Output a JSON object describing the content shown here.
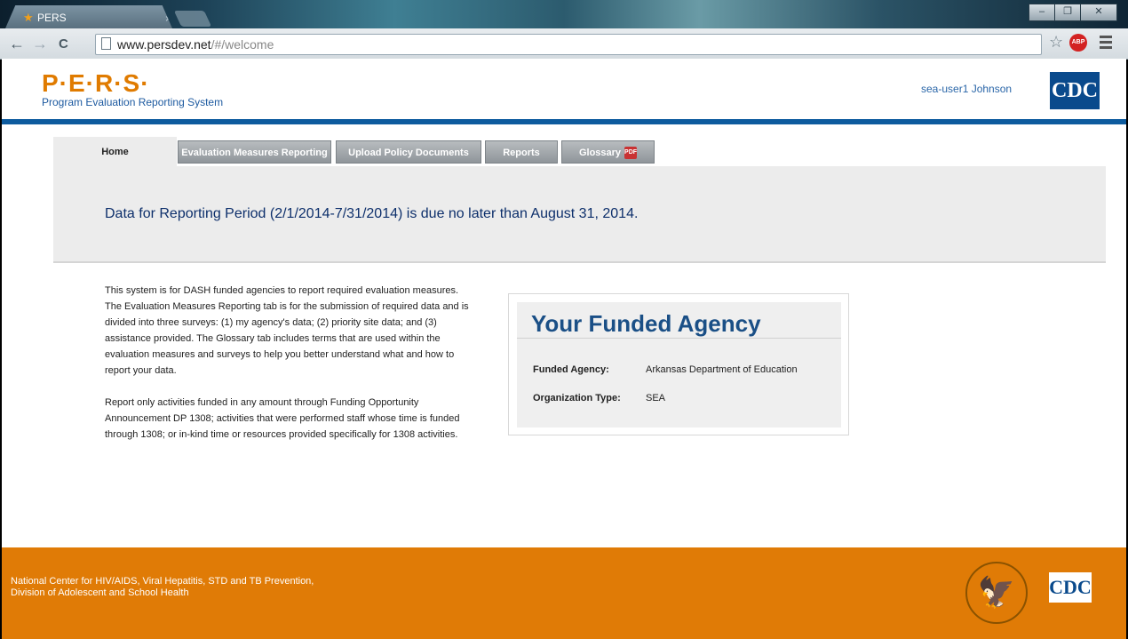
{
  "browser": {
    "tab_title": "PERS",
    "tab_close": "×",
    "url_host": "www.persdev.net",
    "url_path": "/#/welcome",
    "window_buttons": [
      "–",
      "❐",
      "✕"
    ],
    "back_icon": "←",
    "forward_icon": "→",
    "reload_icon": "C",
    "star_icon": "☆",
    "adblock_label": "ABP"
  },
  "header": {
    "logo": "P·E·R·S·",
    "tagline": "Program Evaluation Reporting System",
    "user": "sea-user1 Johnson",
    "cdc_logo": "CDC"
  },
  "nav": {
    "tabs": [
      {
        "label": "Home",
        "active": true
      },
      {
        "label": "Evaluation Measures Reporting"
      },
      {
        "label": "Upload Policy Documents"
      },
      {
        "label": "Reports"
      },
      {
        "label": "Glossary"
      }
    ],
    "pdf_icon": "PDF"
  },
  "banner": {
    "text": "Data for Reporting Period (2/1/2014-7/31/2014) is due no later than August 31, 2014."
  },
  "intro": {
    "p1": "This system is for DASH funded agencies to report required evaluation measures. The Evaluation Measures Reporting tab is for the submission of required data and is divided into three surveys: (1) my agency's data; (2) priority site data; and (3) assistance provided. The Glossary tab includes terms that are used within the evaluation measures and surveys to help you better understand what and how to report your data.",
    "p2": "Report only activities funded in any amount through Funding Opportunity Announcement DP 1308; activities that were performed staff whose time is funded through 1308; or in-kind time or resources provided specifically for 1308 activities."
  },
  "agency": {
    "title": "Your Funded Agency",
    "funded_label": "Funded Agency:",
    "funded_value": "Arkansas Department of Education",
    "type_label": "Organization Type:",
    "type_value": "SEA"
  },
  "footer": {
    "line1": "National Center for HIV/AIDS, Viral Hepatitis, STD and TB Prevention,",
    "line2": "Division of Adolescent and School Health",
    "cdc_logo": "CDC"
  },
  "colors": {
    "accent_orange": "#e07b06",
    "brand_blue": "#0d5b9e",
    "banner_text": "#0d2f6b"
  }
}
